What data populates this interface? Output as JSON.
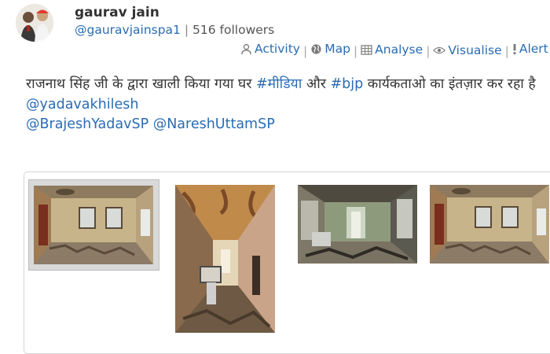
{
  "user": {
    "name": "gaurav jain",
    "handle": "@gauravjainspa1",
    "separator": "|",
    "followers": "516 followers"
  },
  "actions": [
    {
      "label": "Activity",
      "icon": "user-icon"
    },
    {
      "label": "Map",
      "icon": "globe-icon"
    },
    {
      "label": "Analyse",
      "icon": "table-icon"
    },
    {
      "label": "Visualise",
      "icon": "eye-icon"
    },
    {
      "label": "Alert",
      "icon": "exclamation-icon"
    }
  ],
  "tweet": {
    "text_1": "राजनाथ सिंह जी के द्वारा खाली किया गया घर ",
    "hashtag_1": "#मीडिया",
    "text_2": " और ",
    "hashtag_2": "#bjp",
    "text_3": " कार्यकताओ का इंतज़ार कर रहा है",
    "mention_1": "@yadavakhilesh",
    "mention_2": "@BrajeshYadavSP",
    "mention_3": "@NareshUttamSP"
  },
  "media": {
    "count": 4,
    "selected_index": 0,
    "thumbnails": [
      "abandoned-room-photo",
      "abandoned-corridor-photo",
      "damaged-room-photo",
      "abandoned-room-photo"
    ]
  },
  "colors": {
    "link": "#2a6cb3",
    "text": "#333333",
    "muted": "#555555",
    "border": "#d6d6d6"
  }
}
